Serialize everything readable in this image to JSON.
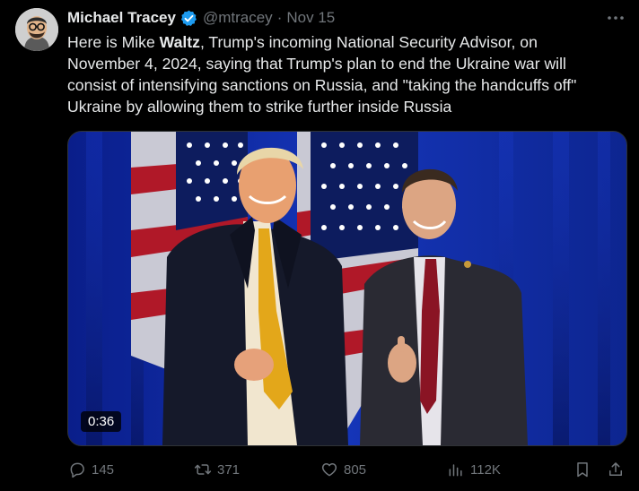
{
  "author": {
    "name": "Michael Tracey",
    "handle": "@mtracey",
    "separator": "·",
    "timestamp": "Nov 15"
  },
  "tweet": {
    "text_lines": [
      {
        "a": "Here is Mike ",
        "b": "Waltz",
        "c": ", Trump's incoming National Security Advisor, on"
      },
      "November 4, 2024, saying that Trump's plan to end the Ukraine war will",
      "consist of intensifying sanctions on Russia, and \"taking the handcuffs off\"",
      "Ukraine by allowing them to strike further inside Russia"
    ]
  },
  "media": {
    "duration": "0:36"
  },
  "actions": {
    "replies": "145",
    "reposts": "371",
    "likes": "805",
    "views": "112K"
  },
  "colors": {
    "background": "#000000",
    "text": "#e7e9ea",
    "muted": "#71767b",
    "verified": "#1d9bf0"
  },
  "icons": [
    "more-icon",
    "verified-icon",
    "reply-icon",
    "repost-icon",
    "like-icon",
    "views-icon",
    "bookmark-icon",
    "share-icon"
  ]
}
